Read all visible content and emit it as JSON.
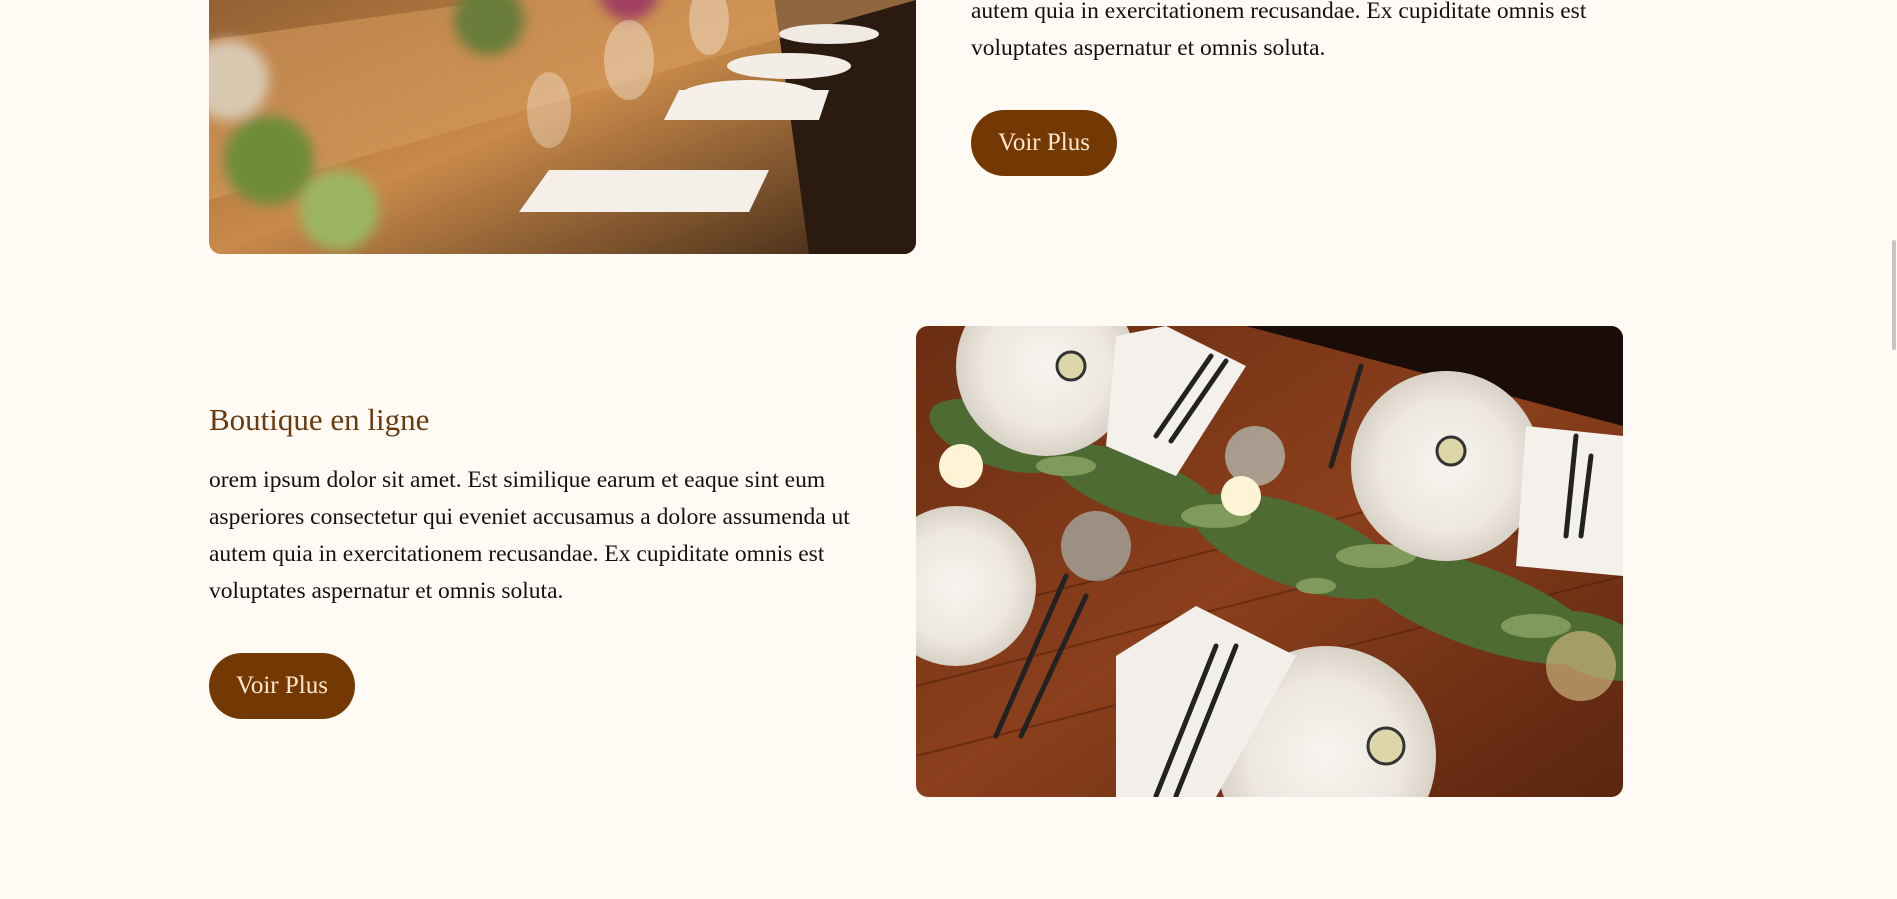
{
  "section1": {
    "paragraph": "autem quia in exercitationem recusandae. Ex cupiditate omnis est voluptates aspernatur et omnis soluta.",
    "button_label": "Voir Plus"
  },
  "section2": {
    "heading": "Boutique en ligne",
    "paragraph": "orem ipsum dolor sit amet. Est similique earum et eaque sint eum asperiores consectetur qui eveniet accusamus a dolore assumenda ut autem quia in exercitationem recusandae. Ex cupiditate omnis est voluptates aspernatur et omnis soluta.",
    "button_label": "Voir Plus"
  },
  "colors": {
    "background": "#fffaf4",
    "button": "#743903",
    "button_text": "#fbe7cf",
    "heading": "#6a3a0f"
  },
  "images": {
    "photo1": "banquet-table-photo",
    "photo2": "table-setting-photo"
  }
}
